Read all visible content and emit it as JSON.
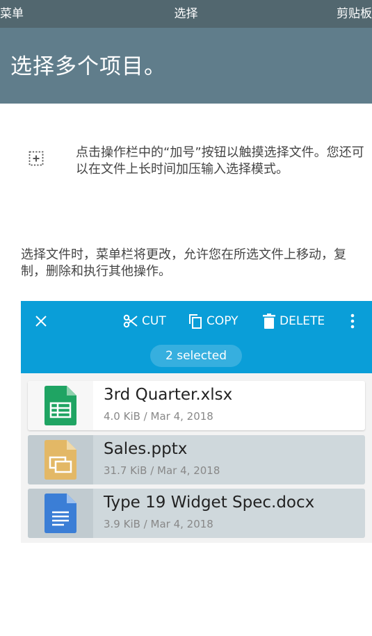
{
  "topbar": {
    "menu_label": "菜单",
    "title": "选择",
    "clipboard_label": "剪贴板"
  },
  "header": {
    "title": "选择多个项目。"
  },
  "hint": {
    "icon": "add-selection-icon",
    "text": "点击操作栏中的“加号”按钮以触摸选择文件。您还可以在文件上长时间加压输入选择模式。"
  },
  "paragraph": "选择文件时，菜单栏将更改，允许您在所选文件上移动，复制，删除和执行其他操作。",
  "actionbar": {
    "close_icon": "close-icon",
    "cut_label": "CUT",
    "copy_label": "COPY",
    "delete_label": "DELETE",
    "more_icon": "more-vertical-icon",
    "selected_label": "2 selected",
    "color": "#0a9ed8"
  },
  "files": [
    {
      "name": "3rd Quarter.xlsx",
      "meta": "4.0 KiB / Mar 4, 2018",
      "icon": "spreadsheet-icon",
      "selected": false
    },
    {
      "name": "Sales.pptx",
      "meta": "31.7 KiB / Mar 4, 2018",
      "icon": "presentation-icon",
      "selected": true
    },
    {
      "name": "Type 19 Widget Spec.docx",
      "meta": "3.9 KiB / Mar 4, 2018",
      "icon": "document-icon",
      "selected": true
    }
  ],
  "colors": {
    "topbar": "#52676f",
    "header": "#607d8b",
    "selected_row": "#cfd8dc",
    "spreadsheet": "#1fa463",
    "presentation": "#e3b866",
    "document": "#3b7ed6"
  }
}
